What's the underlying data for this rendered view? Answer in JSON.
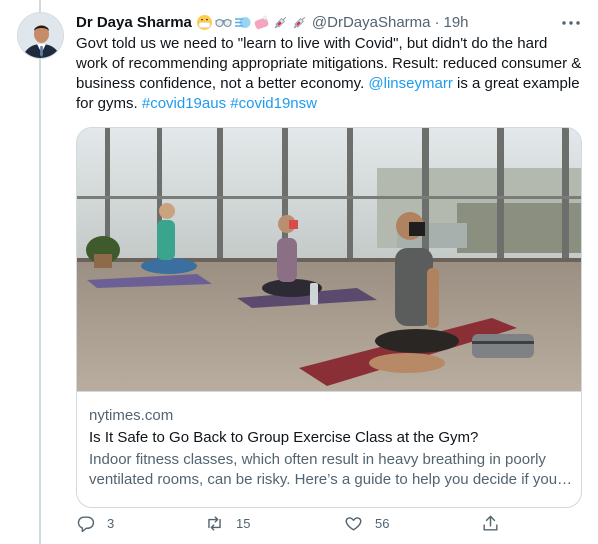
{
  "tweet": {
    "display_name": "Dr Daya Sharma",
    "emoji_names": [
      "mask-face-emoji",
      "goggles-emoji",
      "wind-emoji",
      "soap-emoji",
      "syringe-emoji",
      "syringe-emoji"
    ],
    "handle": "@DrDayaSharma",
    "separator": "·",
    "time": "19h",
    "more_label": "···",
    "text_part1": "Govt told us we need to \"learn to live with Covid\", but didn't do the hard work of recommending appropriate mitigations. Result: reduced consumer & business confidence, not a better economy. ",
    "mention": "@linseymarr",
    "text_part2": " is a great example for gyms. ",
    "hashtag1": "#covid19aus",
    "hashtag_sep": " ",
    "hashtag2": "#covid19nsw"
  },
  "card": {
    "domain": "nytimes.com",
    "title": "Is It Safe to Go Back to Group Exercise Class at the Gym?",
    "description": "Indoor fitness classes, which often result in heavy breathing in poorly ventilated rooms, can be risky. Here’s a guide to help you decide if you…",
    "image_subject": "yoga-class-photo"
  },
  "actions": {
    "reply_count": "3",
    "retweet_count": "15",
    "like_count": "56"
  },
  "colors": {
    "link": "#1d9bf0",
    "secondary_text": "#536471",
    "border": "#cfd9de"
  }
}
